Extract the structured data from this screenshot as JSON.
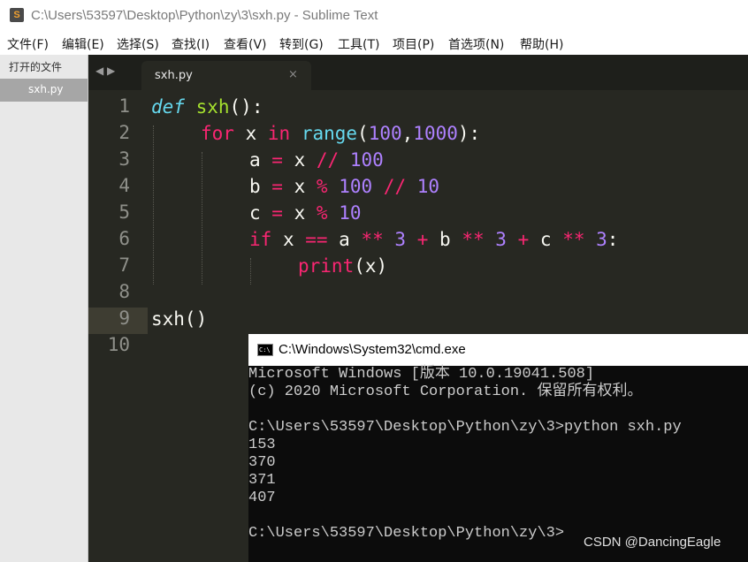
{
  "window": {
    "title": "C:\\Users\\53597\\Desktop\\Python\\zy\\3\\sxh.py - Sublime Text",
    "app_icon_letter": "S"
  },
  "menu": [
    "文件(F)",
    "编辑(E)",
    "选择(S)",
    "查找(I)",
    "查看(V)",
    "转到(G)",
    "工具(T)",
    "项目(P)",
    "首选项(N)",
    "帮助(H)"
  ],
  "sidebar": {
    "header": "打开的文件",
    "active_file": "sxh.py"
  },
  "editor": {
    "nav_arrows": "◀ ▶",
    "tab_label": "sxh.py",
    "tab_close": "×",
    "line_numbers": [
      "1",
      "2",
      "3",
      "4",
      "5",
      "6",
      "7",
      "8",
      "9",
      "10"
    ],
    "current_line": 9
  },
  "code": {
    "l1": {
      "kw": "def",
      "name": "sxh",
      "rest": "():"
    },
    "l2": {
      "kw": "for",
      "a": " x ",
      "in": "in",
      "sp": " ",
      "fn": "range",
      "p1": "(",
      "n1": "100",
      "c": ",",
      "n2": "1000",
      "p2": "):"
    },
    "l3": {
      "a": "a ",
      "eq": "=",
      "b": " x ",
      "op": "//",
      "sp": " ",
      "n": "100"
    },
    "l4": {
      "a": "b ",
      "eq": "=",
      "b": " x ",
      "op": "%",
      "sp": " ",
      "n": "100",
      "sp2": " ",
      "op2": "//",
      "sp3": " ",
      "n2": "10"
    },
    "l5": {
      "a": "c ",
      "eq": "=",
      "b": " x ",
      "op": "%",
      "sp": " ",
      "n": "10"
    },
    "l6": {
      "kw": "if",
      "a": " x ",
      "eq": "==",
      "b": " a ",
      "p1": "**",
      "s1": " ",
      "n1": "3",
      "s2": " ",
      "plus1": "+",
      "c": " b ",
      "p2": "**",
      "s3": " ",
      "n2": "3",
      "s4": " ",
      "plus2": "+",
      "d": " c ",
      "p3": "**",
      "s5": " ",
      "n3": "3",
      "end": ":"
    },
    "l7": {
      "fn": "print",
      "rest": "(x)"
    },
    "l9": "sxh()"
  },
  "cmd": {
    "title": "C:\\Windows\\System32\\cmd.exe",
    "icon_label": "C:\\",
    "lines": [
      "Microsoft Windows [版本 10.0.19041.508]",
      "(c) 2020 Microsoft Corporation. 保留所有权利。",
      "",
      "C:\\Users\\53597\\Desktop\\Python\\zy\\3>python sxh.py",
      "153",
      "370",
      "371",
      "407",
      "",
      "C:\\Users\\53597\\Desktop\\Python\\zy\\3>"
    ]
  },
  "watermark": "CSDN @DancingEagle",
  "colors": {
    "editor_bg": "#272822",
    "keyword": "#f92672",
    "function": "#a6e22e",
    "builtin": "#66d9ef",
    "number": "#ae81ff",
    "text": "#f8f8f2"
  }
}
